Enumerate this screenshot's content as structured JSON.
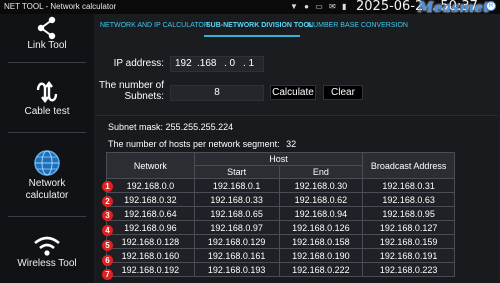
{
  "status_bar": {
    "title": "NET TOOL - Network calculator",
    "clock": "2025-06-2… 50:37",
    "brand": "Measmet",
    "brand_badge": "R"
  },
  "sidebar": {
    "items": [
      {
        "label": "Link Tool",
        "icon": "share-icon"
      },
      {
        "label": "Cable test",
        "icon": "cable-test-icon"
      },
      {
        "label": "Network",
        "label2": "calculator",
        "icon": "globe-icon"
      },
      {
        "label": "Wireless Tool",
        "icon": "wifi-icon"
      }
    ]
  },
  "tabs": [
    {
      "label": "NETWORK AND IP CALCULATOR",
      "active": false
    },
    {
      "label": "SUB-NETWORK DIVISION TOOL",
      "active": true
    },
    {
      "label": "NUMBER BASE CONVERSION",
      "active": false
    }
  ],
  "form": {
    "ip_label": "IP address:",
    "ip_octets": [
      "192",
      ".168",
      ". 0",
      ". 1"
    ],
    "subnets_label_1": "The number of",
    "subnets_label_2": "Subnets:",
    "subnets_value": "8",
    "calculate_label": "Calculate",
    "clear_label": "Clear"
  },
  "results": {
    "subnet_mask_label": "Subnet mask:",
    "subnet_mask": "255.255.255.224",
    "hosts_label": "The number of hosts per network segment:",
    "hosts_value": "32"
  },
  "table": {
    "headers": {
      "network": "Network",
      "host": "Host",
      "start": "Start",
      "end": "End",
      "broadcast": "Broadcast Address"
    },
    "rows": [
      {
        "num": "1",
        "network": "192.168.0.0",
        "start": "192.168.0.1",
        "end": "192.168.0.30",
        "broadcast": "192.168.0.31"
      },
      {
        "num": "2",
        "network": "192.168.0.32",
        "start": "192.168.0.33",
        "end": "192.168.0.62",
        "broadcast": "192.168.0.63"
      },
      {
        "num": "3",
        "network": "192.168.0.64",
        "start": "192.168.0.65",
        "end": "192.168.0.94",
        "broadcast": "192.168.0.95"
      },
      {
        "num": "4",
        "network": "192.168.0.96",
        "start": "192.168.0.97",
        "end": "192.168.0.126",
        "broadcast": "192.168.0.127"
      },
      {
        "num": "5",
        "network": "192.168.0.128",
        "start": "192.168.0.129",
        "end": "192.168.0.158",
        "broadcast": "192.168.0.159"
      },
      {
        "num": "6",
        "network": "192.168.0.160",
        "start": "192.168.0.161",
        "end": "192.168.0.190",
        "broadcast": "192.168.0.191"
      },
      {
        "num": "7",
        "network": "192.168.0.192",
        "start": "192.168.0.193",
        "end": "192.168.0.222",
        "broadcast": "192.168.0.223"
      }
    ]
  },
  "colors": {
    "accent": "#2fb4d8",
    "badge_red": "#e02020",
    "brand_blue": "#4a90e2"
  }
}
